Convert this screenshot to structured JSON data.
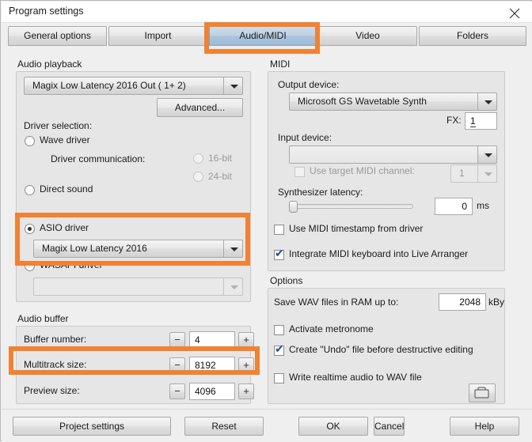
{
  "window": {
    "title": "Program settings",
    "close_icon": "close-icon"
  },
  "tabs": [
    {
      "label": "General options",
      "selected": false
    },
    {
      "label": "Import",
      "selected": false
    },
    {
      "label": "Audio/MIDI",
      "selected": true
    },
    {
      "label": "Video",
      "selected": false
    },
    {
      "label": "Folders",
      "selected": false
    }
  ],
  "audio_playback": {
    "group_label": "Audio playback",
    "device_combo": "Magix Low Latency 2016 Out ( 1+ 2)",
    "advanced_button": "Advanced...",
    "driver_selection_label": "Driver selection:",
    "wave_driver": "Wave driver",
    "driver_communication_label": "Driver communication:",
    "bit16": "16-bit",
    "bit24": "24-bit",
    "direct_sound": "Direct sound",
    "asio_driver": "ASIO driver",
    "asio_combo": "Magix Low Latency 2016",
    "wasapi_driver": "WASAPI driver",
    "wasapi_combo": ""
  },
  "audio_buffer": {
    "group_label": "Audio buffer",
    "rows": [
      {
        "label": "Buffer number:",
        "value": "4"
      },
      {
        "label": "Multitrack size:",
        "value": "8192"
      },
      {
        "label": "Preview size:",
        "value": "4096"
      }
    ],
    "minus_glyph": "−",
    "plus_glyph": "+"
  },
  "midi": {
    "group_label": "MIDI",
    "output_device_label": "Output device:",
    "output_device_combo": "Microsoft GS Wavetable Synth",
    "fx_label": "FX:",
    "fx_value": "1",
    "input_device_label": "Input device:",
    "input_device_combo": "",
    "use_target_midi_channel": "Use target MIDI channel:",
    "midi_channel_value": "1",
    "synth_latency_label": "Synthesizer latency:",
    "synth_latency_value": "0",
    "synth_latency_unit": "ms",
    "use_midi_timestamp": "Use MIDI timestamp from driver",
    "use_midi_timestamp_checked": false,
    "integrate_midi_keyboard": "Integrate MIDI keyboard into Live Arranger",
    "integrate_midi_keyboard_checked": true
  },
  "options": {
    "group_label": "Options",
    "save_wav_label": "Save WAV files in RAM up to:",
    "save_wav_value": "2048",
    "save_wav_unit": "kBy",
    "activate_metronome": "Activate metronome",
    "activate_metronome_checked": false,
    "create_undo": "Create \"Undo\" file before destructive editing",
    "create_undo_checked": true,
    "write_realtime": "Write realtime audio to WAV file",
    "write_realtime_checked": false,
    "browse_icon": "folder-icon"
  },
  "footer": {
    "buttons": [
      "Project settings",
      "Reset",
      "OK",
      "Cancel",
      "Help"
    ]
  },
  "annotations": {
    "highlight_color": "#f08232",
    "boxes": [
      {
        "name": "audio-midi-tab-highlight"
      },
      {
        "name": "asio-driver-highlight"
      },
      {
        "name": "multitrack-size-highlight"
      }
    ]
  },
  "tick_glyph": "✔"
}
